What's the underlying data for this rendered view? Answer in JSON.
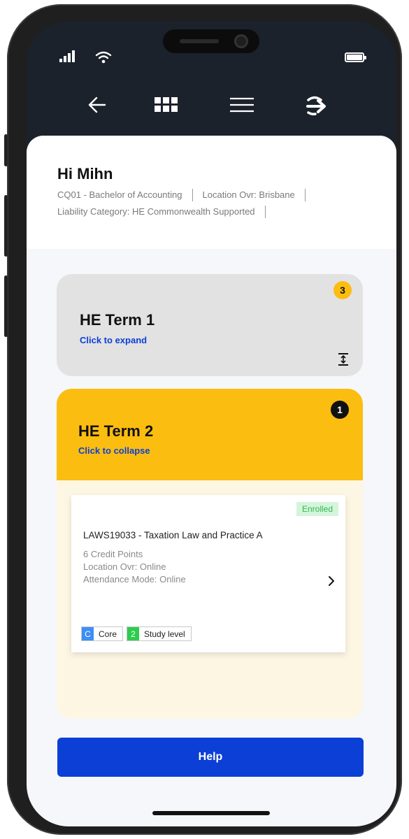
{
  "colors": {
    "accent_blue": "#0b3fd6",
    "term2_yellow": "#fbbd10",
    "term1_grey": "#e2e2e2",
    "enrolled_green": "#2fb84d",
    "core_tag_blue": "#3d8ef5",
    "level_tag_green": "#2ecc4e"
  },
  "nav": {
    "icons": [
      "arrow-left-icon",
      "grid-icon",
      "menu-icon",
      "logout-icon"
    ]
  },
  "header": {
    "greeting": "Hi Mihn",
    "program": "CQ01 - Bachelor of Accounting",
    "location": "Location Ovr: Brisbane",
    "liability": "Liability Category: HE Commonwealth Supported"
  },
  "terms": [
    {
      "title": "HE Term 1",
      "action": "Click to expand",
      "count": "3",
      "state": "collapsed"
    },
    {
      "title": "HE Term 2",
      "action": "Click to collapse",
      "count": "1",
      "state": "expanded",
      "courses": [
        {
          "status": "Enrolled",
          "title": "LAWS19033 - Taxation Law and Practice A",
          "credit_points": "6 Credit Points",
          "location": "Location Ovr: Online",
          "attendance": "Attendance Mode: Online",
          "tags": [
            {
              "key": "C",
              "label": "Core"
            },
            {
              "key": "2",
              "label": "Study level"
            }
          ]
        }
      ]
    }
  ],
  "help_label": "Help"
}
